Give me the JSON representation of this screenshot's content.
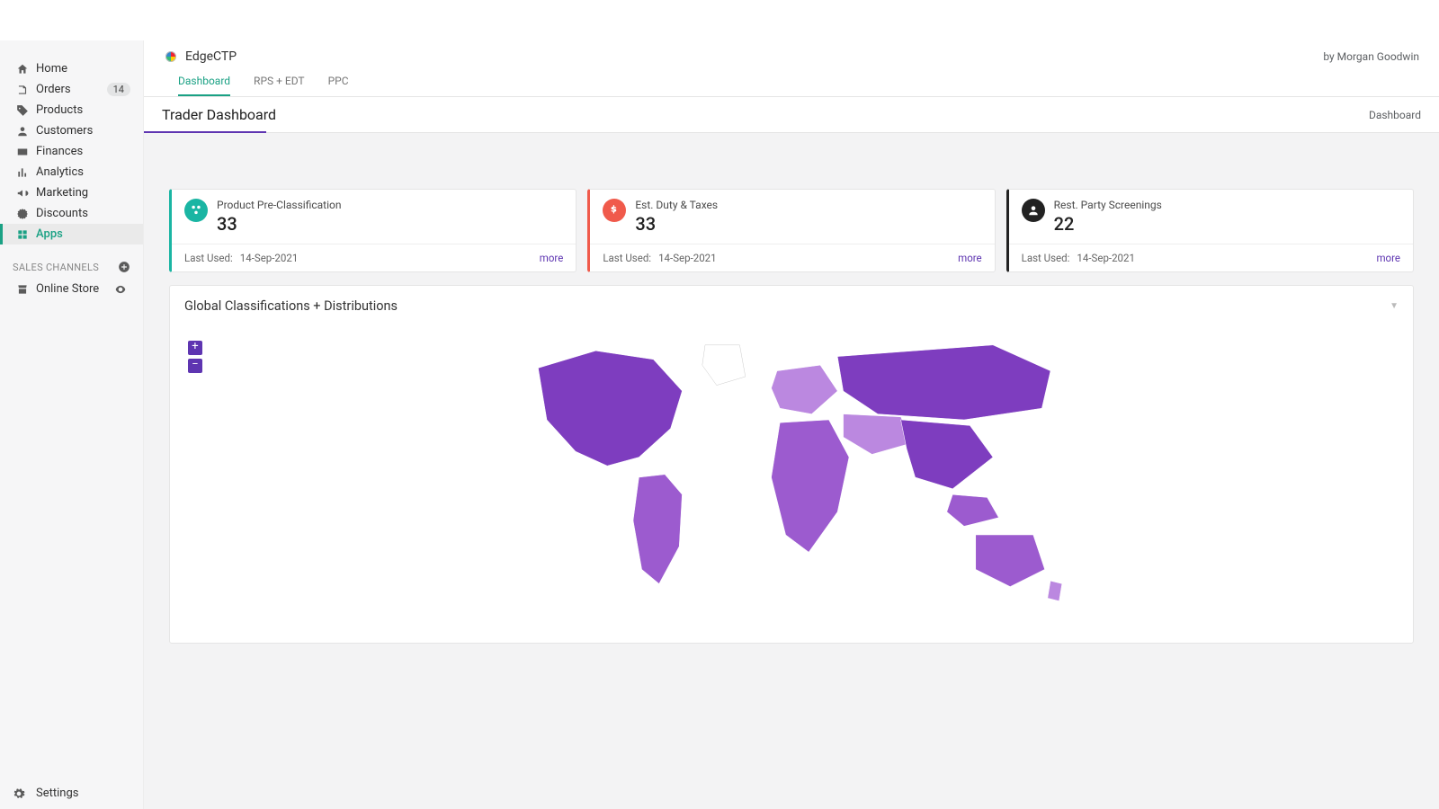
{
  "sidebar": {
    "items": [
      {
        "label": "Home"
      },
      {
        "label": "Orders",
        "badge": "14"
      },
      {
        "label": "Products"
      },
      {
        "label": "Customers"
      },
      {
        "label": "Finances"
      },
      {
        "label": "Analytics"
      },
      {
        "label": "Marketing"
      },
      {
        "label": "Discounts"
      },
      {
        "label": "Apps"
      }
    ],
    "section_label": "SALES CHANNELS",
    "online_store": "Online Store",
    "settings": "Settings"
  },
  "header": {
    "app_name": "EdgeCTP",
    "author": "by Morgan Goodwin",
    "tabs": [
      "Dashboard",
      "RPS + EDT",
      "PPC"
    ]
  },
  "subheader": {
    "title": "Trader Dashboard",
    "crumb": "Dashboard"
  },
  "cards": [
    {
      "title": "Product Pre-Classification",
      "value": "33",
      "last_used_label": "Last Used:",
      "date": "14-Sep-2021",
      "more": "more"
    },
    {
      "title": "Est. Duty & Taxes",
      "value": "33",
      "last_used_label": "Last Used:",
      "date": "14-Sep-2021",
      "more": "more"
    },
    {
      "title": "Rest. Party Screenings",
      "value": "22",
      "last_used_label": "Last Used:",
      "date": "14-Sep-2021",
      "more": "more"
    }
  ],
  "panel": {
    "title": "Global Classifications + Distributions",
    "zoom_in": "+",
    "zoom_out": "−"
  },
  "colors": {
    "accent_teal": "#1aa184",
    "accent_purple": "#5e35b1",
    "map_base": "#9c5bcf"
  }
}
